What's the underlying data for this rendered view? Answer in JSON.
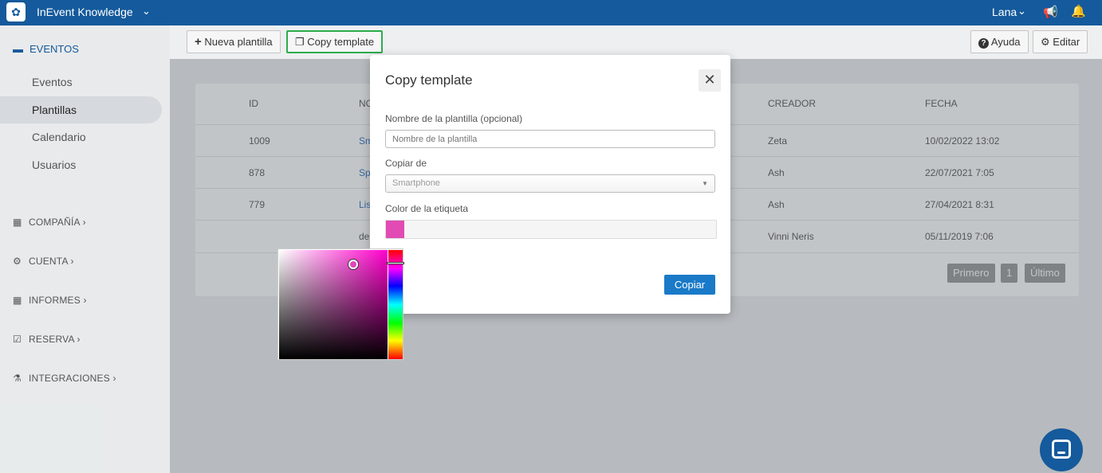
{
  "topbar": {
    "logo_glyph": "✿",
    "app_name": "InEvent Knowledge",
    "app_chevron": "⌄",
    "user_name": "Lana",
    "user_chevron": "⌄",
    "megaphone_glyph": "📢",
    "bell_glyph": "🔔"
  },
  "sidebar": {
    "section_title": "EVENTOS",
    "section_icon": "▬",
    "items": [
      {
        "label": "Eventos"
      },
      {
        "label": "Plantillas"
      },
      {
        "label": "Calendario"
      },
      {
        "label": "Usuarios"
      }
    ],
    "groups": [
      {
        "label": "COMPAÑÍA",
        "icon": "▦",
        "chevron": "›"
      },
      {
        "label": "CUENTA",
        "icon": "⚙",
        "chevron": "›"
      },
      {
        "label": "INFORMES",
        "icon": "▦",
        "chevron": "›"
      },
      {
        "label": "RESERVA",
        "icon": "☑",
        "chevron": "›"
      },
      {
        "label": "INTEGRACIONES",
        "icon": "⚗",
        "chevron": "›"
      }
    ]
  },
  "toolbar": {
    "new_template": "Nueva plantilla",
    "new_icon": "+",
    "copy_template": "Copy template",
    "copy_icon": "❐",
    "help": "Ayuda",
    "help_icon": "?",
    "edit": "Editar",
    "edit_icon": "⚙"
  },
  "table": {
    "headers": {
      "id": "ID",
      "name": "NO",
      "creator": "CREADOR",
      "date": "FECHA"
    },
    "rows": [
      {
        "id": "1009",
        "name": "Sm",
        "creator": "Zeta",
        "date": "10/02/2022 13:02"
      },
      {
        "id": "878",
        "name": "Sp",
        "creator": "Ash",
        "date": "22/07/2021 7:05"
      },
      {
        "id": "779",
        "name": "Lis",
        "creator": "Ash",
        "date": "27/04/2021 8:31"
      },
      {
        "id": "",
        "name": "de",
        "creator": "Vinni Neris",
        "date": "05/11/2019 7:06"
      }
    ],
    "pager": {
      "first": "Primero",
      "page": "1",
      "last": "Último"
    }
  },
  "modal": {
    "title": "Copy template",
    "close_glyph": "✕",
    "name_label": "Nombre de la plantilla (opcional)",
    "name_placeholder": "Nombre de la plantilla",
    "name_value": "",
    "copy_from_label": "Copiar de",
    "copy_from_value": "Smartphone",
    "select_caret": "▼",
    "color_label": "Color de la etiqueta",
    "color_value": "#e24ab4",
    "submit": "Copiar"
  },
  "colors": {
    "brand": "#145a9c",
    "accent_button": "#1a7ac8",
    "highlight": "#2bb34a",
    "picker_hue": "#ff00cc"
  }
}
